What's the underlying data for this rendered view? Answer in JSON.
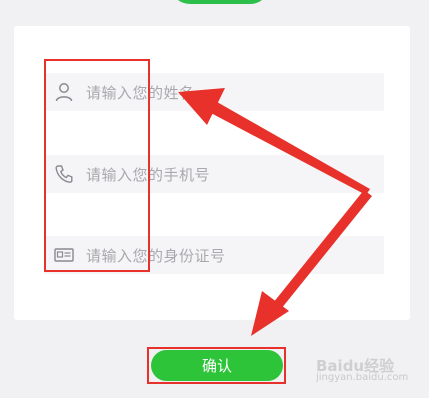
{
  "form": {
    "name_placeholder": "请输入您的姓名",
    "phone_placeholder": "请输入您的手机号",
    "id_placeholder": "请输入您的身份证号"
  },
  "icons": {
    "name": "person-icon",
    "phone": "phone-icon",
    "id": "id-card-icon"
  },
  "actions": {
    "confirm_label": "确认"
  },
  "colors": {
    "accent_green": "#2ec43a",
    "annotation_red": "#e8312a",
    "placeholder_gray": "#a9a9ad"
  },
  "watermark": {
    "brand": "Baidu经验",
    "url": "jingyan.baidu.com"
  }
}
